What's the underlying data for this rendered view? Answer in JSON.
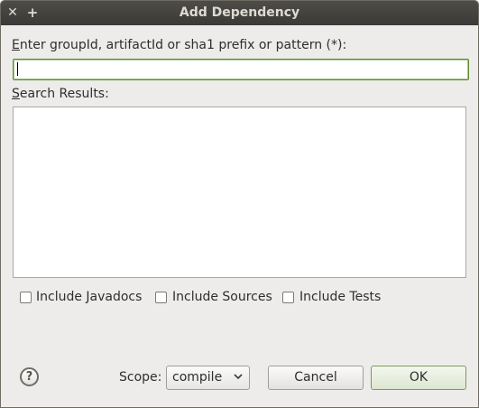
{
  "window": {
    "title": "Add Dependency",
    "close_glyph": "✕",
    "max_glyph": "+"
  },
  "search": {
    "label_mnemonic": "E",
    "label_rest": "nter groupId, artifactId or sha1 prefix or pattern (*):",
    "value": ""
  },
  "results": {
    "label_mnemonic": "S",
    "label_rest": "earch Results:",
    "items": []
  },
  "options": [
    {
      "label": "Include Javadocs",
      "checked": false
    },
    {
      "label": "Include Sources",
      "checked": false
    },
    {
      "label": "Include Tests",
      "checked": false
    }
  ],
  "footer": {
    "help_glyph": "?",
    "scope_label": "Scope:",
    "scope_value": "compile",
    "cancel_label": "Cancel",
    "ok_label": "OK"
  },
  "colors": {
    "focus_border": "#5f8a35",
    "titlebar": "#3b3a36"
  }
}
